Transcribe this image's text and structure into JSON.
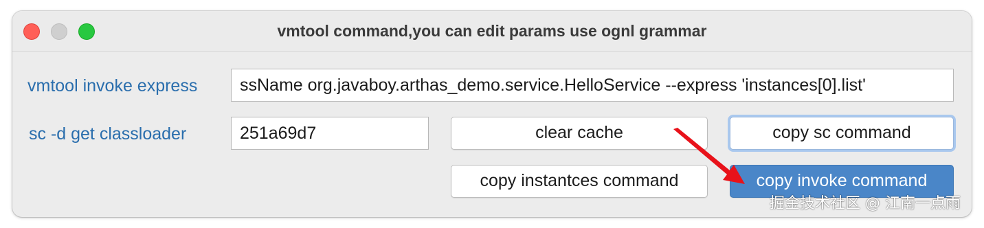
{
  "window": {
    "title": "vmtool command,you can edit params use ognl grammar"
  },
  "form": {
    "invoke_label": "vmtool invoke express",
    "invoke_value": "ssName org.javaboy.arthas_demo.service.HelloService  --express 'instances[0].list'",
    "classloader_label": "sc -d get classloader",
    "classloader_value": "251a69d7"
  },
  "buttons": {
    "clear_cache": "clear cache",
    "copy_sc": "copy sc command",
    "copy_instances": "copy instantces command",
    "copy_invoke": "copy invoke command"
  },
  "watermark": "掘金技术社区 @ 江南一点雨",
  "colors": {
    "label": "#2a6ead",
    "primary_button": "#4a86c8",
    "arrow": "#e8121a",
    "close": "#ff5f57",
    "maximize": "#28c840"
  }
}
